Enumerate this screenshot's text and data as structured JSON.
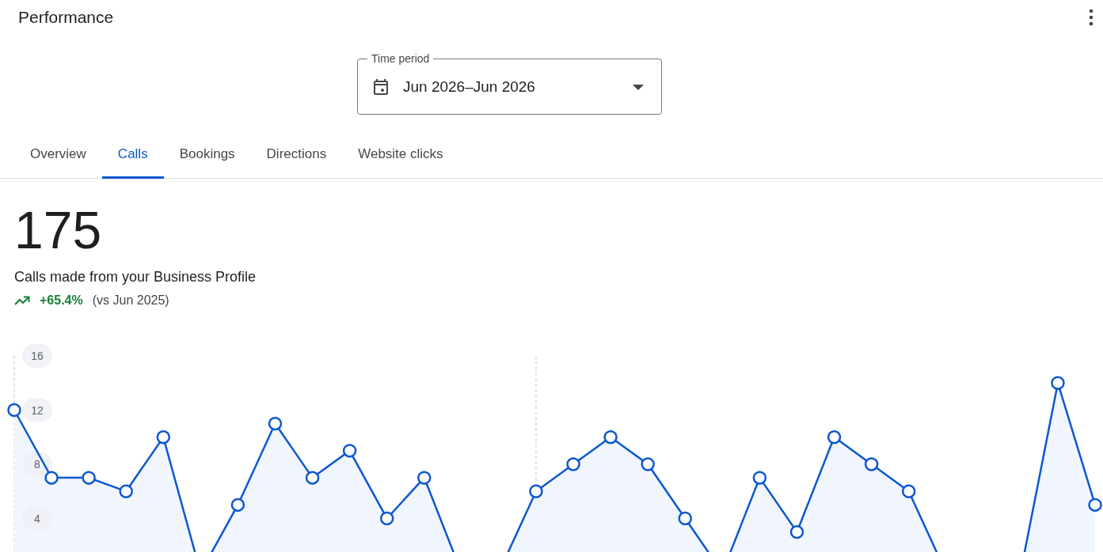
{
  "header": {
    "title": "Performance"
  },
  "time_period": {
    "label": "Time period",
    "value": "Jun 2026–Jun 2026"
  },
  "tabs": [
    {
      "label": "Overview",
      "selected": false
    },
    {
      "label": "Calls",
      "selected": true
    },
    {
      "label": "Bookings",
      "selected": false
    },
    {
      "label": "Directions",
      "selected": false
    },
    {
      "label": "Website clicks",
      "selected": false
    }
  ],
  "metric": {
    "value": "175",
    "description": "Calls made from your Business Profile",
    "change": "+65.4%",
    "comparison": "(vs Jun 2025)"
  },
  "chart_data": {
    "type": "area",
    "ylim": [
      0,
      16
    ],
    "yticks": [
      4,
      8,
      12,
      16
    ],
    "series": [
      {
        "color": "#0b57d0",
        "values": [
          12,
          7,
          7,
          6,
          10,
          0,
          5,
          11,
          7,
          9,
          4,
          7,
          0,
          0,
          6,
          8,
          10,
          8,
          4,
          0,
          7,
          3,
          10,
          8,
          6,
          0,
          0,
          0,
          14,
          5
        ]
      }
    ]
  }
}
